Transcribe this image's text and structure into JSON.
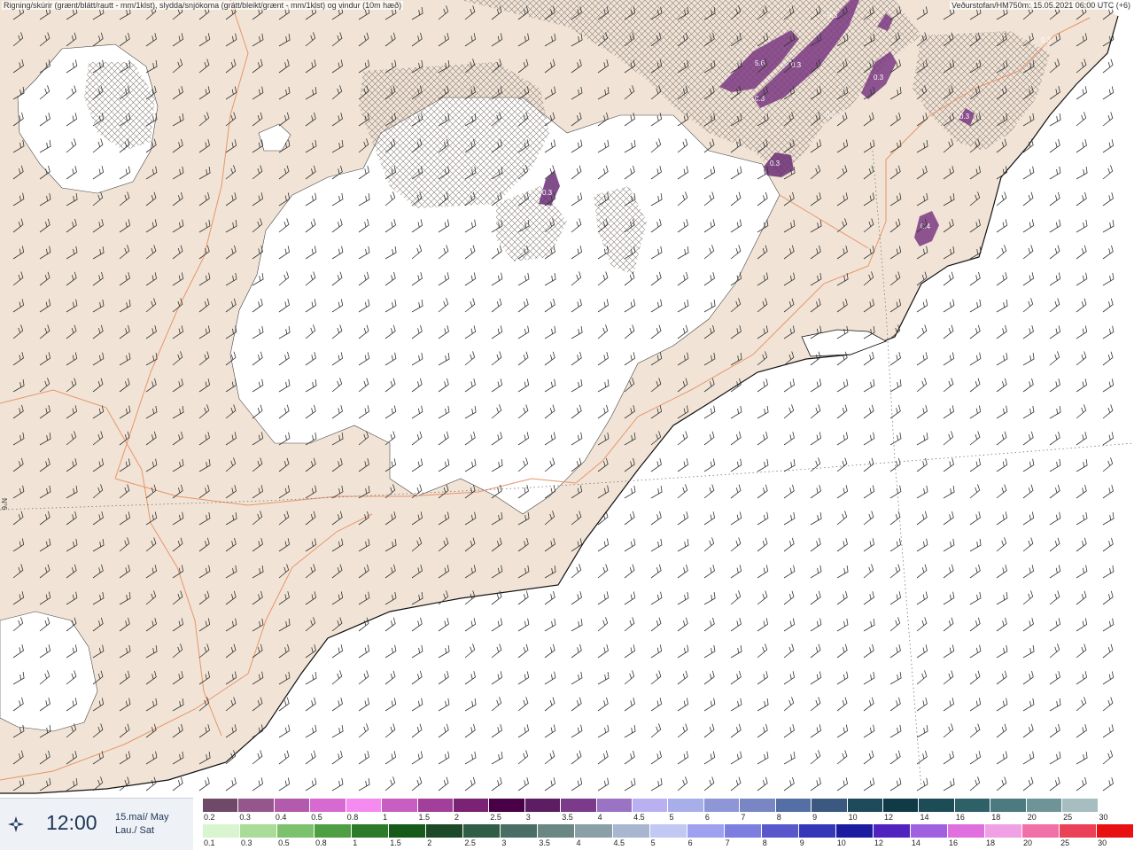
{
  "header": {
    "left_title": "Rigning/skúrir (grænt/blátt/rautt - mm/1klst), slydda/snjókoma (grátt/bleikt/grænt - mm/1klst) og vindur (10m hæð)",
    "right_title": "Veðurstofan/HM750m: 15.05.2021 06:00 UTC (+6)"
  },
  "map": {
    "grid_label": "N°6",
    "colors": {
      "land": "#f1e4d6",
      "sea": "#ffffff",
      "glacier": "#ffffff",
      "roads": "#e8946a",
      "coast": "#111111",
      "barbs": "#333333",
      "snow_hatch": "#8a7f7a"
    },
    "precip_labels": [
      "0.3",
      "5.6",
      "0.3",
      "0.3",
      "0.3",
      "0.3",
      "0.3",
      "0.3",
      "0.3",
      "0.4",
      "0.3"
    ]
  },
  "timebox": {
    "icon": "compass-rose-icon",
    "time": "12:00",
    "date_line1": "15.maí/ May",
    "date_line2": "Lau./ Sat"
  },
  "scale_top": {
    "labels": [
      "0.2",
      "0.3",
      "0.4",
      "0.5",
      "0.8",
      "1",
      "1.5",
      "2",
      "2.5",
      "3",
      "3.5",
      "4",
      "4.5",
      "5",
      "6",
      "7",
      "8",
      "9",
      "10",
      "12",
      "14",
      "16",
      "18",
      "20",
      "25",
      "30"
    ],
    "colors": [
      "#6e4a68",
      "#94568c",
      "#b25aac",
      "#d66ad0",
      "#f58af0",
      "#c85ec2",
      "#a13f9b",
      "#7a2274",
      "#4a0046",
      "#5c1d63",
      "#7c3a8a",
      "#9a73c4",
      "#b8b0f0",
      "#a8aeea",
      "#8e96d8",
      "#7886c4",
      "#546ea6",
      "#3a5880",
      "#1f4a5a",
      "#0f3a46",
      "#1c4c56",
      "#2e6068",
      "#4b7a80",
      "#6f9498",
      "#a7bec0",
      "#ffffff"
    ]
  },
  "scale_bottom": {
    "labels": [
      "0.1",
      "0.3",
      "0.5",
      "0.8",
      "1",
      "1.5",
      "2",
      "2.5",
      "3",
      "3.5",
      "4",
      "4.5",
      "5",
      "6",
      "7",
      "8",
      "9",
      "10",
      "12",
      "14",
      "16",
      "18",
      "20",
      "25",
      "30"
    ],
    "colors": [
      "#d9f5d0",
      "#a8dc98",
      "#7cc26c",
      "#4e9e44",
      "#2d7a2a",
      "#155a18",
      "#1c4a28",
      "#2f5d46",
      "#4a6e66",
      "#6a8784",
      "#8aa0a6",
      "#a8b6d0",
      "#c2c8f4",
      "#9ea2ee",
      "#7c7ee0",
      "#5858cc",
      "#3636b8",
      "#1c1ca0",
      "#5022c0",
      "#a060e0",
      "#e070e0",
      "#f0a0e4",
      "#f070a8",
      "#ea4058",
      "#e81010"
    ]
  }
}
